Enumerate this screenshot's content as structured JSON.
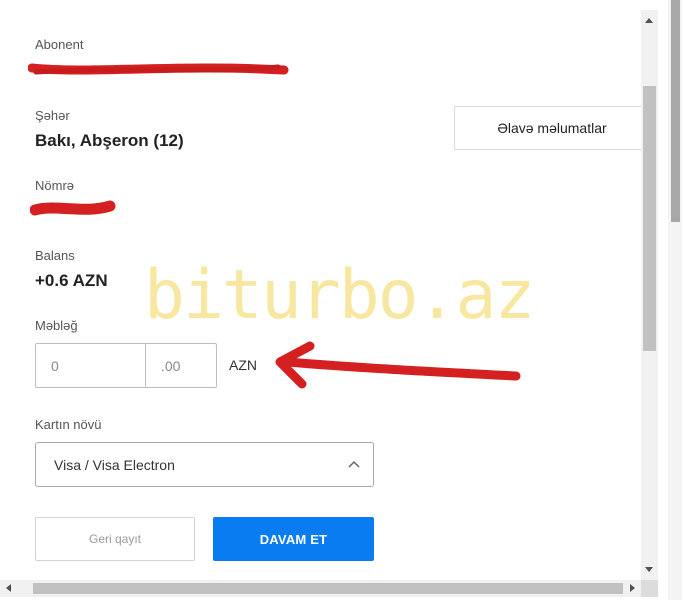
{
  "form": {
    "subscriber_label": "Abonent",
    "city_label": "Şəhər",
    "city_value": "Bakı, Abşeron (12)",
    "number_label": "Nömrə",
    "balance_label": "Balans",
    "balance_value": "+0.6 AZN",
    "amount_label": "Məbləğ",
    "amount_int_placeholder": "0",
    "amount_dec_placeholder": ".00",
    "currency": "AZN",
    "card_type_label": "Kartın növü",
    "card_type_selected": "Visa / Visa Electron",
    "more_info_button": "Əlavə məlumatlar",
    "back_button": "Geri qayıt",
    "continue_button": "DAVAM ET"
  },
  "watermark": "biturbo.az",
  "colors": {
    "primary": "#0a7cf2",
    "watermark": "#f7e7a1",
    "scribble": "#d42020"
  },
  "icons": {
    "select_chevron": "chevron-up-icon"
  }
}
